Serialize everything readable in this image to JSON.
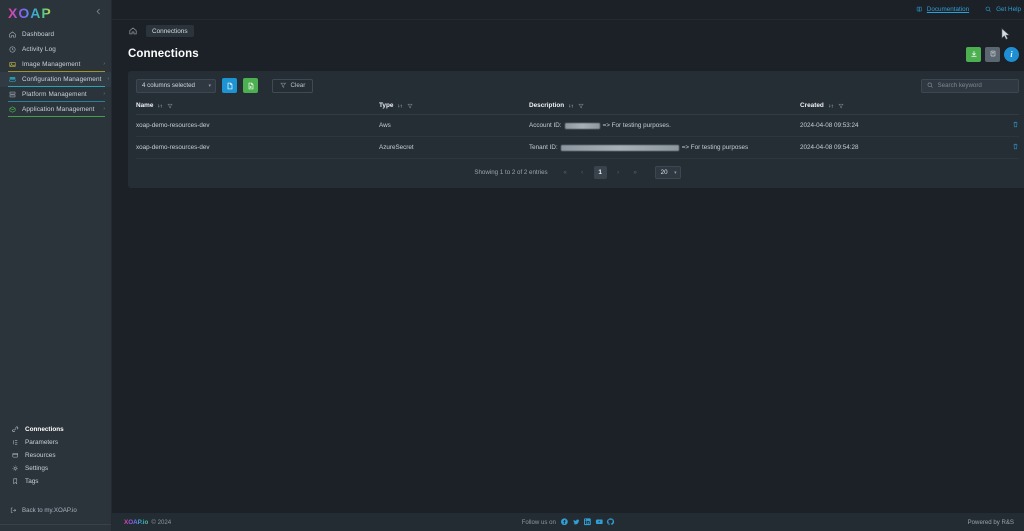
{
  "brand": {
    "logo": "XOAP",
    "collapse_icon": "chevron-left-icon"
  },
  "topbar": {
    "links": [
      {
        "label": "Documentation",
        "icon": "book-icon"
      },
      {
        "label": "Get Help",
        "icon": "search-help-icon"
      }
    ]
  },
  "sidebar": {
    "main_items": [
      {
        "label": "Dashboard",
        "icon": "home-icon",
        "accent": "",
        "expandable": false,
        "active": false
      },
      {
        "label": "Activity Log",
        "icon": "clock-icon",
        "accent": "",
        "expandable": false,
        "active": false
      },
      {
        "label": "Image Management",
        "icon": "image-icon",
        "accent": "#b5a52a",
        "expandable": true,
        "active": false
      },
      {
        "label": "Configuration Management",
        "icon": "sliders-icon",
        "accent": "#2bb5c9",
        "expandable": true,
        "active": true
      },
      {
        "label": "Platform Management",
        "icon": "server-icon",
        "accent": "#2a8fa8",
        "expandable": true,
        "active": false
      },
      {
        "label": "Application Management",
        "icon": "package-icon",
        "accent": "#4caf50",
        "expandable": true,
        "active": false
      }
    ],
    "sub_items": [
      {
        "label": "Connections",
        "icon": "link-icon",
        "active": true
      },
      {
        "label": "Parameters",
        "icon": "list-icon",
        "active": false
      },
      {
        "label": "Resources",
        "icon": "box-icon",
        "active": false
      },
      {
        "label": "Settings",
        "icon": "gear-icon",
        "active": false
      },
      {
        "label": "Tags",
        "icon": "tag-icon",
        "active": false
      }
    ],
    "back_link": {
      "label": "Back to my.XOAP.io",
      "icon": "logout-icon"
    }
  },
  "breadcrumb": {
    "home_icon": "home-icon",
    "current": "Connections"
  },
  "page": {
    "title": "Connections"
  },
  "page_actions": [
    {
      "name": "import-button",
      "icon": "import-icon",
      "color": "#4caf50"
    },
    {
      "name": "export-button",
      "icon": "export-icon",
      "color": "#5b6670"
    },
    {
      "name": "info-button",
      "icon": "info-icon",
      "label": "i",
      "color": "#1e8fd4"
    }
  ],
  "table_toolbar": {
    "columns_select": {
      "value": "4 columns selected",
      "chevron": "chevron-down-icon"
    },
    "buttons": [
      {
        "name": "export-csv-button",
        "icon": "file-csv-icon",
        "color": "#1e93d4"
      },
      {
        "name": "export-excel-button",
        "icon": "file-excel-icon",
        "color": "#4caf50"
      }
    ],
    "clear": {
      "label": "Clear",
      "icon": "filter-clear-icon"
    },
    "search": {
      "placeholder": "Search keyword",
      "value": "",
      "icon": "search-icon"
    }
  },
  "table": {
    "columns": [
      {
        "label": "Name",
        "sort_icon": "sort-icon",
        "filter_icon": "filter-icon"
      },
      {
        "label": "Type",
        "sort_icon": "sort-icon",
        "filter_icon": "filter-icon"
      },
      {
        "label": "Description",
        "sort_icon": "sort-icon",
        "filter_icon": "filter-icon"
      },
      {
        "label": "Created",
        "sort_icon": "sort-icon",
        "filter_icon": "filter-icon"
      }
    ],
    "rows": [
      {
        "name": "xoap-demo-resources-dev",
        "type": "Aws",
        "desc_prefix": "Account ID:",
        "desc_redacted_width": 35,
        "desc_suffix": "=> For testing purposes.",
        "created": "2024-04-08 09:53:24",
        "action_icon": "trash-icon"
      },
      {
        "name": "xoap-demo-resources-dev",
        "type": "AzureSecret",
        "desc_prefix": "Tenant ID:",
        "desc_redacted_width": 118,
        "desc_suffix": "=> For testing purposes",
        "created": "2024-04-08 09:54:28",
        "action_icon": "trash-icon"
      }
    ]
  },
  "pagination": {
    "info": "Showing 1 to 2 of 2 entries",
    "first": "«",
    "prev": "‹",
    "current_page": "1",
    "next": "›",
    "last": "»",
    "page_size": "20",
    "page_size_chevron": "chevron-down-icon"
  },
  "footer": {
    "logo": "XOAP.io",
    "copyright": "© 2024",
    "follow_label": "Follow us on",
    "socials": [
      {
        "name": "facebook-icon"
      },
      {
        "name": "twitter-icon"
      },
      {
        "name": "linkedin-icon"
      },
      {
        "name": "youtube-icon"
      },
      {
        "name": "github-icon"
      }
    ],
    "powered_by": "Powered by R&S"
  },
  "colors": {
    "sidebar_bg": "#2b333b",
    "main_bg": "#1b2127",
    "card_bg": "#262e35",
    "accent_blue": "#1e93d4",
    "accent_green": "#4caf50",
    "link": "#2f9fd6"
  }
}
